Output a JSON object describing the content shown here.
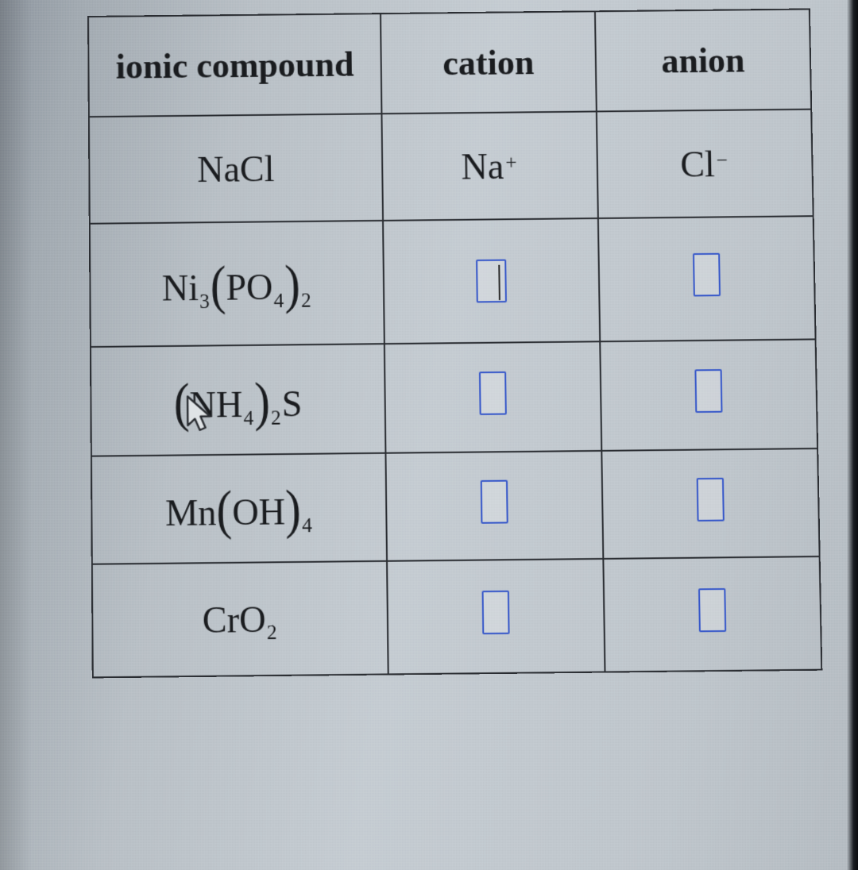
{
  "table": {
    "headers": {
      "compound": "ionic compound",
      "cation": "cation",
      "anion": "anion"
    },
    "rows": [
      {
        "compound": {
          "text": "NaCl",
          "parts": [
            "Na",
            "Cl"
          ]
        },
        "cation": {
          "type": "formula",
          "base": "Na",
          "sup": "+"
        },
        "anion": {
          "type": "formula",
          "base": "Cl",
          "sup": "−"
        }
      },
      {
        "compound": {
          "text": "Ni3(PO4)2",
          "display": "Ni₃(PO₄)₂"
        },
        "cation": {
          "type": "input",
          "focused": true
        },
        "anion": {
          "type": "input"
        }
      },
      {
        "compound": {
          "text": "(NH4)2S",
          "display": "(NH₄)₂S",
          "cursor_overlay": true
        },
        "cation": {
          "type": "input"
        },
        "anion": {
          "type": "input"
        }
      },
      {
        "compound": {
          "text": "Mn(OH)4",
          "display": "Mn(OH)₄"
        },
        "cation": {
          "type": "input"
        },
        "anion": {
          "type": "input"
        }
      },
      {
        "compound": {
          "text": "CrO2",
          "display": "CrO₂"
        },
        "cation": {
          "type": "input"
        },
        "anion": {
          "type": "input"
        }
      }
    ]
  },
  "glyphs": {
    "plus": "+",
    "minus": "−",
    "lparen": "(",
    "rparen": ")"
  },
  "parts": {
    "Na": "Na",
    "Cl": "Cl",
    "Ni": "Ni",
    "PO": "PO",
    "four": "4",
    "three": "3",
    "two": "2",
    "NH": "NH",
    "S": "S",
    "Mn": "Mn",
    "OH": "OH",
    "Cr": "Cr",
    "O": "O"
  }
}
